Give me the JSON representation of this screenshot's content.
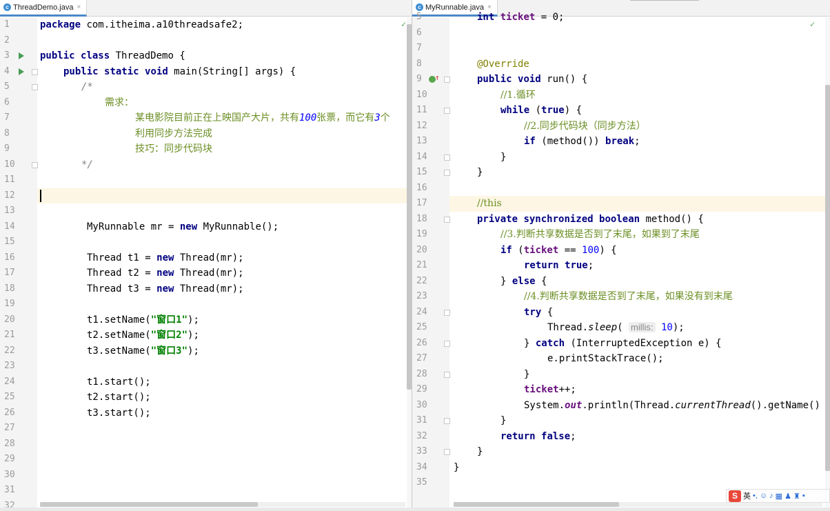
{
  "left": {
    "tab": {
      "icon": "c",
      "title": "ThreadDemo.java",
      "close": "×"
    },
    "line_numbers": [
      "1",
      "2",
      "3",
      "4",
      "5",
      "6",
      "7",
      "8",
      "9",
      "10",
      "11",
      "12",
      "13",
      "14",
      "15",
      "16",
      "17",
      "18",
      "19",
      "20",
      "21",
      "22",
      "23",
      "24",
      "25",
      "26",
      "27",
      "28",
      "29",
      "30",
      "31",
      "32"
    ],
    "run_icon_lines": [
      3,
      4
    ],
    "highlight_line": 12,
    "caret_line": 12,
    "check": "✓",
    "code": {
      "l1": {
        "kw": "package",
        "rest": " com.itheima.a10threadsafe2;"
      },
      "l3": {
        "kw1": "public",
        "kw2": "class",
        "rest": " ThreadDemo {"
      },
      "l4": {
        "kw1": "public",
        "kw2": "static",
        "kw3": "void",
        "rest": " main(String[] args) {"
      },
      "l5": "/*",
      "l6": "需求：",
      "l7": {
        "pre": "某电影院目前正在上映国产大片，共有",
        "num": "100",
        "mid": "张票，而它有",
        "num2": "3",
        "post": "个"
      },
      "l8": "利用同步方法完成",
      "l9": "技巧：同步代码块",
      "l10": "*/",
      "l14": {
        "pre": "MyRunnable mr = ",
        "kw": "new",
        "post": " MyRunnable();"
      },
      "l16": {
        "pre": "Thread t1 = ",
        "kw": "new",
        "post": " Thread(mr);"
      },
      "l17": {
        "pre": "Thread t2 = ",
        "kw": "new",
        "post": " Thread(mr);"
      },
      "l18": {
        "pre": "Thread t3 = ",
        "kw": "new",
        "post": " Thread(mr);"
      },
      "l20": {
        "pre": "t1.setName(",
        "str": "\"窗口1\"",
        "post": ");"
      },
      "l21": {
        "pre": "t2.setName(",
        "str": "\"窗口2\"",
        "post": ");"
      },
      "l22": {
        "pre": "t3.setName(",
        "str": "\"窗口3\"",
        "post": ");"
      },
      "l24": "t1.start();",
      "l25": "t2.start();",
      "l26": "t3.start();"
    }
  },
  "right": {
    "tab": {
      "icon": "c",
      "title": "MyRunnable.java",
      "close": "×"
    },
    "line_numbers": [
      "5",
      "6",
      "7",
      "8",
      "9",
      "10",
      "11",
      "12",
      "13",
      "14",
      "15",
      "16",
      "17",
      "18",
      "19",
      "20",
      "21",
      "22",
      "23",
      "24",
      "25",
      "26",
      "27",
      "28",
      "29",
      "30",
      "31",
      "32",
      "33",
      "34",
      "35"
    ],
    "highlight_line": 17,
    "check": "✓",
    "code": {
      "l5": {
        "kw": "int",
        "fld": "ticket",
        "rest": " = 0;"
      },
      "l8": "@Override",
      "l9": {
        "kw1": "public",
        "kw2": "void",
        "rest": " run() {"
      },
      "l10": "//1.循环",
      "l11": {
        "kw": "while",
        "mid": " (",
        "kw2": "true",
        "post": ") {"
      },
      "l12": "//2.同步代码块（同步方法）",
      "l13": {
        "kw": "if",
        "mid": " (method()) ",
        "kw2": "break",
        "post": ";"
      },
      "l14": "}",
      "l15": "}",
      "l17": "//this",
      "l18": {
        "kw1": "private",
        "kw2": "synchronized",
        "kw3": "boolean",
        "rest": " method() {"
      },
      "l19": "//3.判断共享数据是否到了末尾，如果到了末尾",
      "l20": {
        "kw": "if",
        "mid": " (",
        "fld": "ticket",
        "mid2": " == ",
        "num": "100",
        "post": ") {"
      },
      "l21": {
        "kw": "return",
        "kw2": "true",
        "post": ";"
      },
      "l22": {
        "pre": "} ",
        "kw": "else",
        "post": " {"
      },
      "l23": "//4.判断共享数据是否到了末尾，如果没有到末尾",
      "l24": {
        "kw": "try",
        "post": " {"
      },
      "l25": {
        "pre": "Thread.",
        "st": "sleep",
        "mid": "( ",
        "hint": "millis:",
        "num": "10",
        "post": ");"
      },
      "l26": {
        "pre": "} ",
        "kw": "catch",
        "post": " (InterruptedException e) {"
      },
      "l27": "e.printStackTrace();",
      "l28": "}",
      "l29": {
        "fld": "ticket",
        "post": "++;"
      },
      "l30": {
        "pre": "System.",
        "stf": "out",
        "mid": ".println(Thread.",
        "st": "currentThread",
        "post": "().getName()"
      },
      "l31": "}",
      "l32": {
        "kw": "return",
        "kw2": "false",
        "post": ";"
      },
      "l33": "}",
      "l34": "}"
    }
  },
  "ime": {
    "logo": "S",
    "lang": "英"
  },
  "colors": {
    "keyword": "#000080",
    "comment": "#808080",
    "string": "#008000",
    "number": "#0000ff",
    "annotation": "#808000",
    "field": "#660e7a",
    "highlight": "#fdf6e4"
  }
}
